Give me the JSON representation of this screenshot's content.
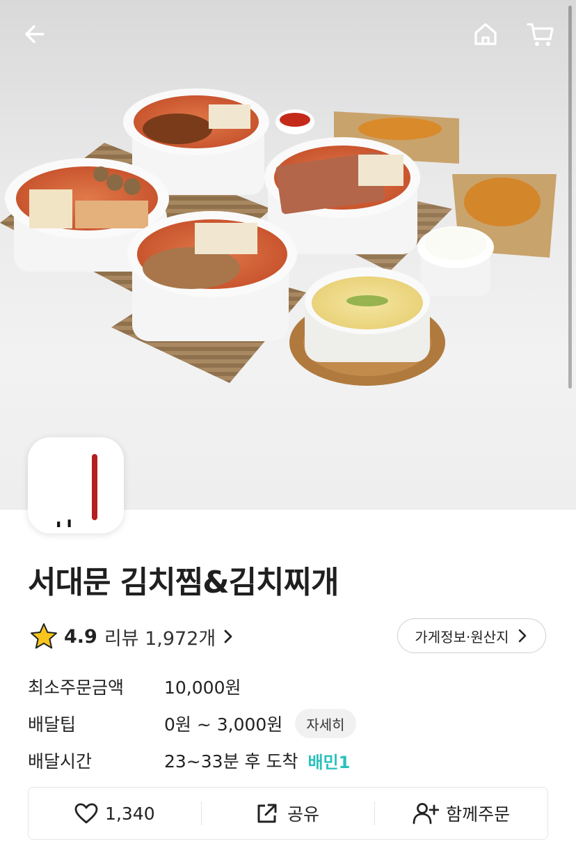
{
  "store": {
    "name": "서대문 김치찜&김치찌개",
    "logo_text": "서대문",
    "rating": "4.9",
    "reviews_label": "리뷰 1,972개"
  },
  "info_button_label": "가게정보·원산지",
  "info": [
    {
      "key": "최소주문금액",
      "value": "10,000원"
    },
    {
      "key": "배달팁",
      "value": "0원 ~ 3,000원",
      "chip": "자세히"
    },
    {
      "key": "배달시간",
      "value": "23~33분 후 도착",
      "badge": "배민1"
    }
  ],
  "actions": {
    "like_count": "1,340",
    "share_label": "공유",
    "group_order_label": "함께주문"
  },
  "icons": {
    "back": "arrow-left-icon",
    "home": "home-icon",
    "cart": "cart-icon",
    "star": "star-icon",
    "heart": "heart-icon",
    "share": "share-icon",
    "add_user": "add-user-icon"
  },
  "colors": {
    "baemin_teal": "#2ac1bc",
    "star_yellow": "#f7c51e"
  }
}
